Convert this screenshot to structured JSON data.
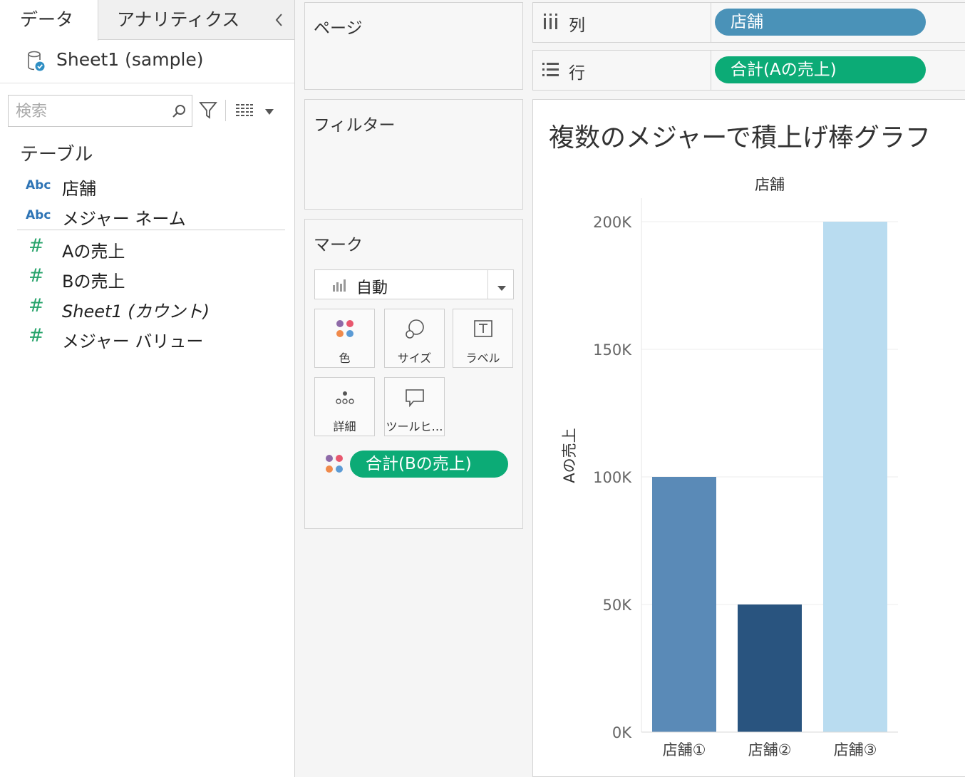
{
  "left_pane": {
    "tabs": [
      "データ",
      "アナリティクス"
    ],
    "datasource_name": "Sheet1 (sample)",
    "search_placeholder": "検索",
    "section_title": "テーブル",
    "dimensions": [
      {
        "type": "Abc",
        "name": "店舗"
      },
      {
        "type": "Abc",
        "name": "メジャー ネーム"
      }
    ],
    "measures": [
      {
        "type": "#",
        "name": "Aの売上"
      },
      {
        "type": "#",
        "name": "Bの売上"
      },
      {
        "type": "#",
        "name": "Sheet1 (カウント)"
      },
      {
        "type": "#",
        "name": "メジャー バリュー"
      }
    ]
  },
  "pages": {
    "title": "ページ"
  },
  "filters": {
    "title": "フィルター"
  },
  "marks": {
    "title": "マーク",
    "mark_type": "自動",
    "buttons": [
      "色",
      "サイズ",
      "ラベル",
      "詳細",
      "ツールヒ…"
    ],
    "color_pill": "合計(Bの売上)"
  },
  "shelves": {
    "columns_label": "列",
    "columns_pill": "店舗",
    "rows_label": "行",
    "rows_pill": "合計(Aの売上)"
  },
  "colors": {
    "green_pill": "#0cab76",
    "blue_pill": "#4a92b8",
    "bar1": "#5a8ab7",
    "bar2": "#29547f",
    "bar3": "#b9dcf0"
  },
  "chart_data": {
    "type": "bar",
    "title": "複数のメジャーで積上げ棒グラフ",
    "column_header": "店舗",
    "ylabel": "Aの売上",
    "categories": [
      "店舗①",
      "店舗②",
      "店舗③"
    ],
    "values": [
      100000,
      50000,
      200000
    ],
    "bar_colors": [
      "#5a8ab7",
      "#29547f",
      "#b9dcf0"
    ],
    "ylim": [
      0,
      200000
    ],
    "yticks": [
      {
        "value": 0,
        "label": "0K"
      },
      {
        "value": 50000,
        "label": "50K"
      },
      {
        "value": 100000,
        "label": "100K"
      },
      {
        "value": 150000,
        "label": "150K"
      },
      {
        "value": 200000,
        "label": "200K"
      }
    ],
    "grid": true
  }
}
